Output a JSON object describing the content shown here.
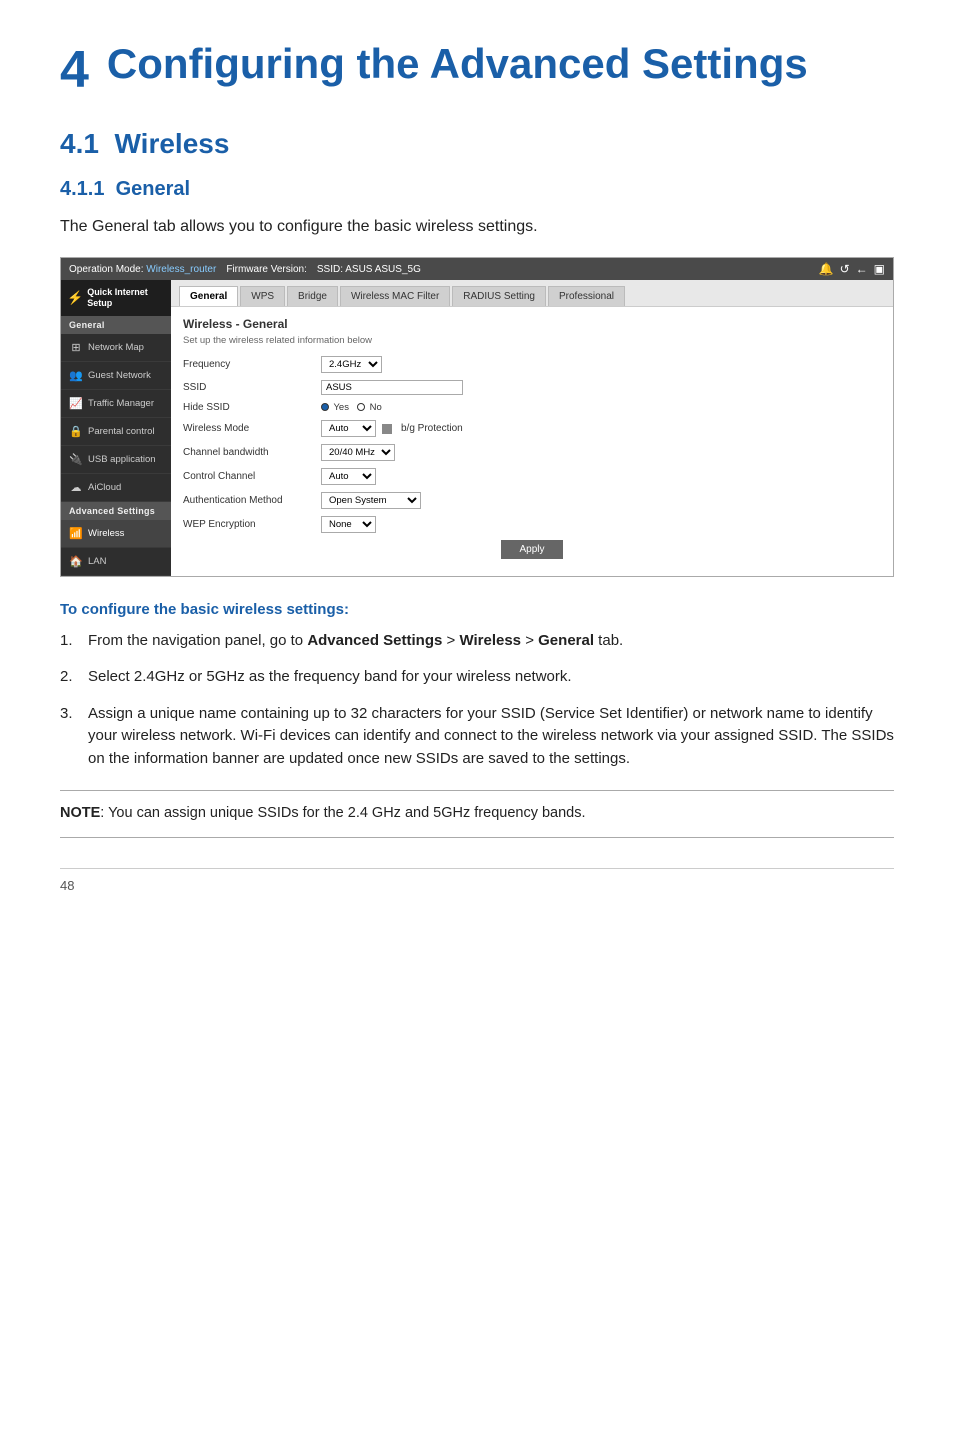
{
  "chapter": {
    "number": "4",
    "title": "Configuring the Advanced Settings"
  },
  "section_4_1": {
    "label": "4.1",
    "title": "Wireless"
  },
  "section_4_1_1": {
    "label": "4.1.1",
    "title": "General"
  },
  "intro": "The General tab allows you to configure the basic wireless settings.",
  "router_ui": {
    "topbar": {
      "operation_mode_label": "Operation Mode:",
      "operation_mode_value": "Wireless_router",
      "firmware_label": "Firmware Version:",
      "ssid_label": "SSID:",
      "ssid_value": "ASUS ASUS_5G"
    },
    "tabs": [
      "General",
      "WPS",
      "Bridge",
      "Wireless MAC Filter",
      "RADIUS Setting",
      "Professional"
    ],
    "panel_title": "Wireless - General",
    "panel_subtitle": "Set up the wireless related information below",
    "fields": [
      {
        "label": "Frequency",
        "type": "select",
        "value": "2.4GHz"
      },
      {
        "label": "SSID",
        "type": "text",
        "value": "ASUS"
      },
      {
        "label": "Hide SSID",
        "type": "radio",
        "options": [
          "Yes",
          "No"
        ],
        "selected": "Yes"
      },
      {
        "label": "Wireless Mode",
        "type": "select_check",
        "value": "Auto",
        "checkbox_label": "b/g Protection"
      },
      {
        "label": "Channel bandwidth",
        "type": "select",
        "value": "20/40 MHz"
      },
      {
        "label": "Control Channel",
        "type": "select",
        "value": "Auto"
      },
      {
        "label": "Authentication Method",
        "type": "select",
        "value": "Open System"
      },
      {
        "label": "WEP Encryption",
        "type": "select",
        "value": "None"
      }
    ],
    "apply_button": "Apply",
    "sidebar_items": [
      {
        "icon": "⚡",
        "label": "Quick Internet Setup",
        "active": false
      },
      {
        "section": "General"
      },
      {
        "icon": "⊞",
        "label": "Network Map",
        "active": false
      },
      {
        "icon": "👥",
        "label": "Guest Network",
        "active": false
      },
      {
        "icon": "📈",
        "label": "Traffic Manager",
        "active": false
      },
      {
        "icon": "🔒",
        "label": "Parental control",
        "active": false
      },
      {
        "icon": "💾",
        "label": "USB application",
        "active": false
      },
      {
        "icon": "☁",
        "label": "AiCloud",
        "active": false
      },
      {
        "section": "Advanced Settings"
      },
      {
        "icon": "📶",
        "label": "Wireless",
        "active": true
      },
      {
        "icon": "🏠",
        "label": "LAN",
        "active": false
      }
    ]
  },
  "instructions_heading": "To configure the basic wireless settings:",
  "instructions": [
    {
      "num": "1.",
      "text_before": "From the navigation panel, go to ",
      "bold1": "Advanced Settings",
      "text_mid": " > ",
      "bold2": "Wireless",
      "text_mid2": " > ",
      "bold3": "General",
      "text_after": " tab."
    },
    {
      "num": "2.",
      "text": "Select 2.4GHz or 5GHz as the frequency band for your wireless network."
    },
    {
      "num": "3.",
      "text": "Assign a unique name containing up to 32 characters for your SSID (Service Set Identifier) or network name to identify your wireless network. Wi-Fi devices can identify and connect to the wireless network via your assigned SSID. The SSIDs on the information banner are updated once new SSIDs are saved to the settings."
    }
  ],
  "note": {
    "label": "NOTE",
    "text": ":  You can assign unique SSIDs for the 2.4 GHz and 5GHz frequency bands."
  },
  "page_number": "48"
}
